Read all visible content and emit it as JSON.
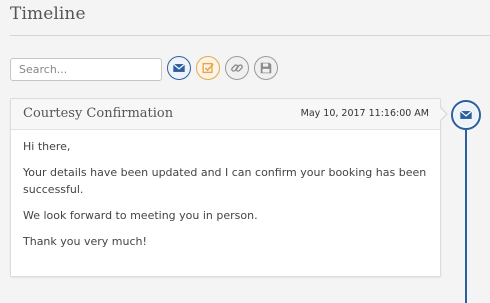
{
  "header": {
    "title": "Timeline"
  },
  "toolbar": {
    "search_placeholder": "Search...",
    "search_value": "",
    "buttons": [
      {
        "icon": "envelope-icon",
        "color": "#2c5fa0"
      },
      {
        "icon": "checkbox-icon",
        "color": "#e8a54b"
      },
      {
        "icon": "link-icon",
        "color": "#9a9a9a"
      },
      {
        "icon": "floppy-disk-icon",
        "color": "#9a9a9a"
      }
    ]
  },
  "entry": {
    "title": "Courtesy Confirmation",
    "date": "May 10, 2017 11:16:00 AM",
    "icon": "envelope-icon",
    "paragraphs": [
      "Hi there,",
      "Your details have been updated and I can confirm your booking has been successful.",
      "We look forward to meeting you in person.",
      "Thank you very much!"
    ]
  },
  "colors": {
    "accent": "#2c5fa0",
    "orange": "#e8a54b",
    "grey": "#9a9a9a"
  }
}
